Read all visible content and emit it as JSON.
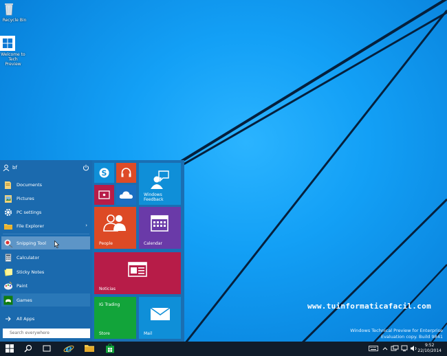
{
  "desktop": {
    "icons": [
      {
        "label": "Recycle Bin",
        "icon": "recycle-bin-icon"
      },
      {
        "label": "Welcome to Tech Preview",
        "icon": "windows-logo-icon"
      }
    ],
    "watermark_url": "www.tuinformaticafacil.com",
    "watermark_line1": "Windows Technical Preview for Enterprise",
    "watermark_line2": "Evaluation copy. Build 9841"
  },
  "start_menu": {
    "user_name": "bf",
    "items": [
      {
        "label": "Documents",
        "icon": "documents-folder-icon"
      },
      {
        "label": "Pictures",
        "icon": "pictures-folder-icon"
      },
      {
        "label": "PC settings",
        "icon": "gear-icon"
      },
      {
        "label": "File Explorer",
        "icon": "file-explorer-icon"
      },
      {
        "label": "Snipping Tool",
        "icon": "scissors-icon"
      },
      {
        "label": "Calculator",
        "icon": "calculator-icon"
      },
      {
        "label": "Sticky Notes",
        "icon": "sticky-notes-icon"
      },
      {
        "label": "Paint",
        "icon": "paint-palette-icon"
      },
      {
        "label": "Games",
        "icon": "gamepad-icon"
      }
    ],
    "all_apps": "All Apps",
    "search_placeholder": "Search everywhere",
    "tiles": [
      {
        "label": "",
        "icon": "skype-icon",
        "color": "#0f8fd8"
      },
      {
        "label": "",
        "icon": "headphones-icon",
        "color": "#de4b27"
      },
      {
        "label": "Windows Feedback",
        "icon": "feedback-icon",
        "color": "#0f8fd8"
      },
      {
        "label": "",
        "icon": "video-icon",
        "color": "#b71c48"
      },
      {
        "label": "",
        "icon": "onedrive-icon",
        "color": "#1a6fc2"
      },
      {
        "label": "People",
        "icon": "people-icon",
        "color": "#dd4a25"
      },
      {
        "label": "Calendar",
        "icon": "calendar-icon",
        "color": "#6a3aa8"
      },
      {
        "label": "Noticias",
        "icon": "news-icon",
        "color": "#b71c48"
      },
      {
        "label": "IG Trading",
        "icon": "",
        "color": "#12a43a"
      },
      {
        "label": "Store",
        "icon": "",
        "color": "#12a43a"
      },
      {
        "label": "Mail",
        "icon": "mail-icon",
        "color": "#0f8fd8"
      }
    ]
  },
  "taskbar": {
    "time": "9:52",
    "date": "22/10/2014"
  }
}
